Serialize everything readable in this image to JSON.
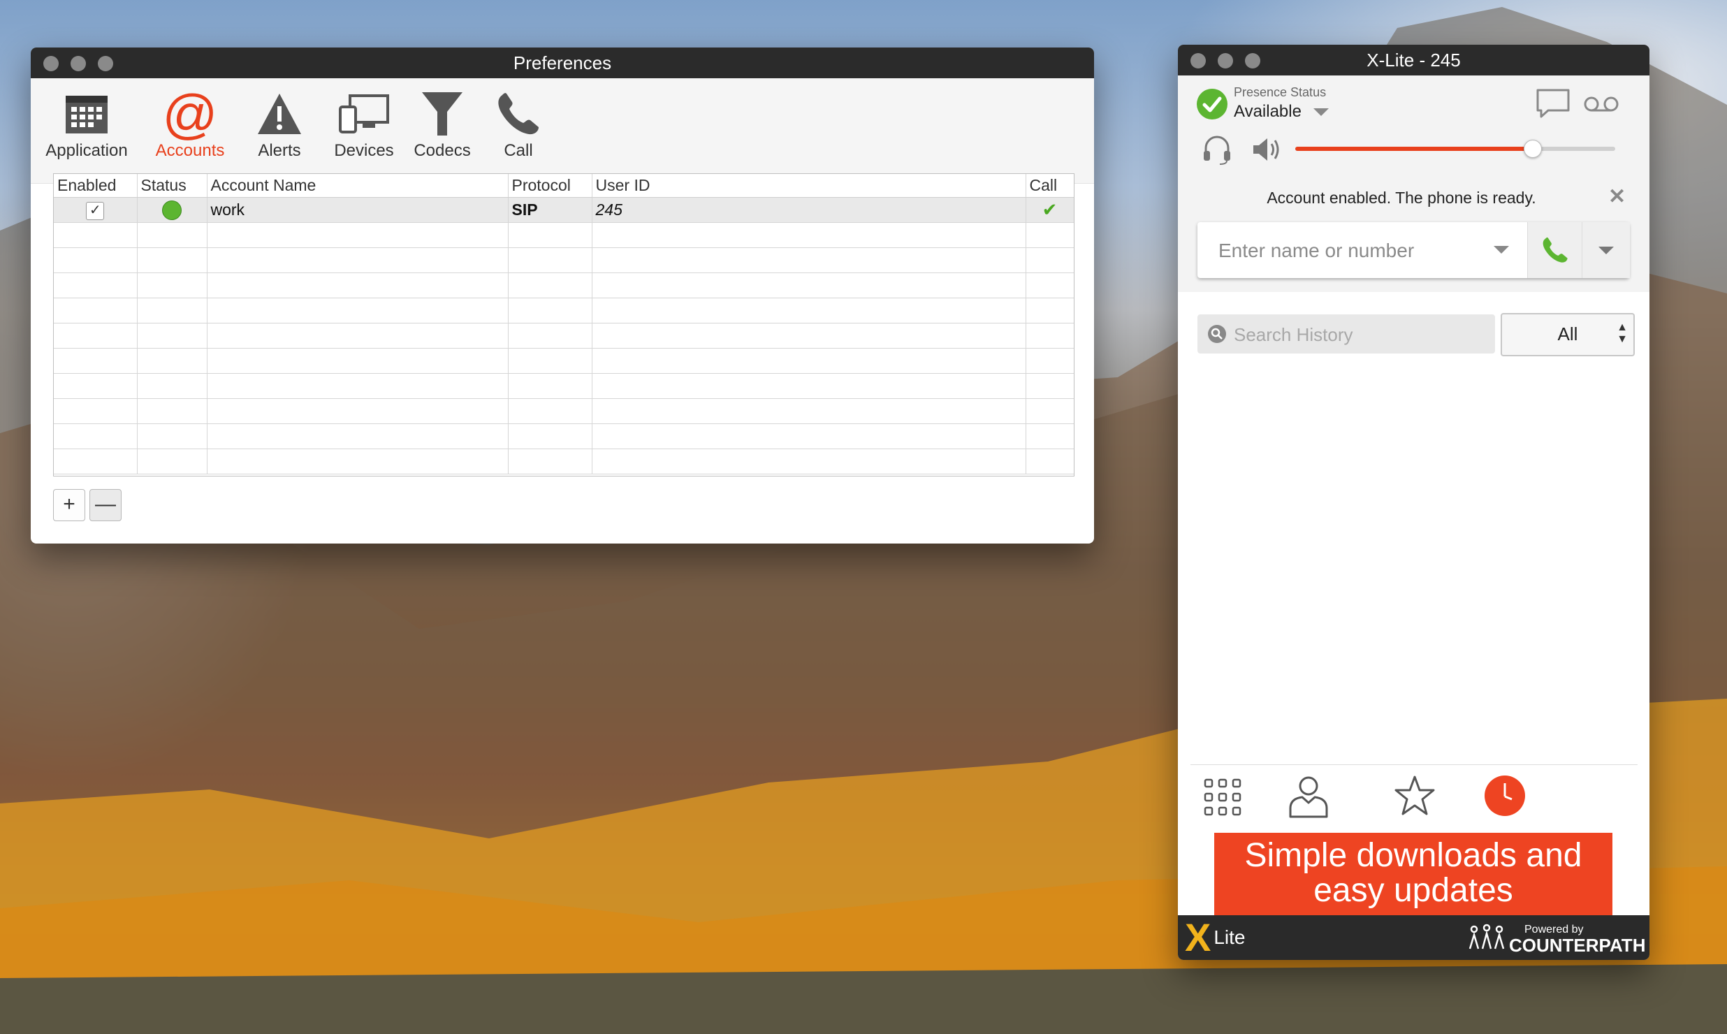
{
  "preferences": {
    "title": "Preferences",
    "toolbar": [
      {
        "label": "Application",
        "icon": "calendar-grid-icon",
        "active": false
      },
      {
        "label": "Accounts",
        "icon": "at-sign-icon",
        "active": true
      },
      {
        "label": "Alerts",
        "icon": "warning-icon",
        "active": false
      },
      {
        "label": "Devices",
        "icon": "monitor-phone-icon",
        "active": false
      },
      {
        "label": "Codecs",
        "icon": "funnel-icon",
        "active": false
      },
      {
        "label": "Call",
        "icon": "phone-icon",
        "active": false
      }
    ],
    "columns": {
      "enabled": "Enabled",
      "status": "Status",
      "account_name": "Account Name",
      "protocol": "Protocol",
      "user_id": "User ID",
      "call": "Call"
    },
    "rows": [
      {
        "enabled": true,
        "status": "online",
        "account_name": "work",
        "protocol": "SIP",
        "user_id": "245",
        "call": true
      }
    ],
    "add_label": "+",
    "remove_label": "—",
    "accent_color": "#e8401c"
  },
  "xlite": {
    "title": "X-Lite - 245",
    "presence_label": "Presence Status",
    "presence_value": "Available",
    "volume_level": 0.74,
    "status_message": "Account enabled. The phone is ready.",
    "dial_placeholder": "Enter name or number",
    "search_placeholder": "Search History",
    "filter_value": "All",
    "nav": [
      {
        "icon": "dialpad-icon",
        "active": false
      },
      {
        "icon": "contacts-icon",
        "active": false
      },
      {
        "icon": "favorites-star-icon",
        "active": false
      },
      {
        "icon": "history-clock-icon",
        "active": true
      }
    ],
    "ad_line1": "Simple downloads and",
    "ad_line2": "easy updates",
    "footer_logo_x": "X",
    "footer_logo_text": "Lite",
    "powered_by": "Powered by",
    "brand": "COUNTERPATH",
    "colors": {
      "accent": "#ee4422",
      "green": "#5cb531"
    }
  }
}
